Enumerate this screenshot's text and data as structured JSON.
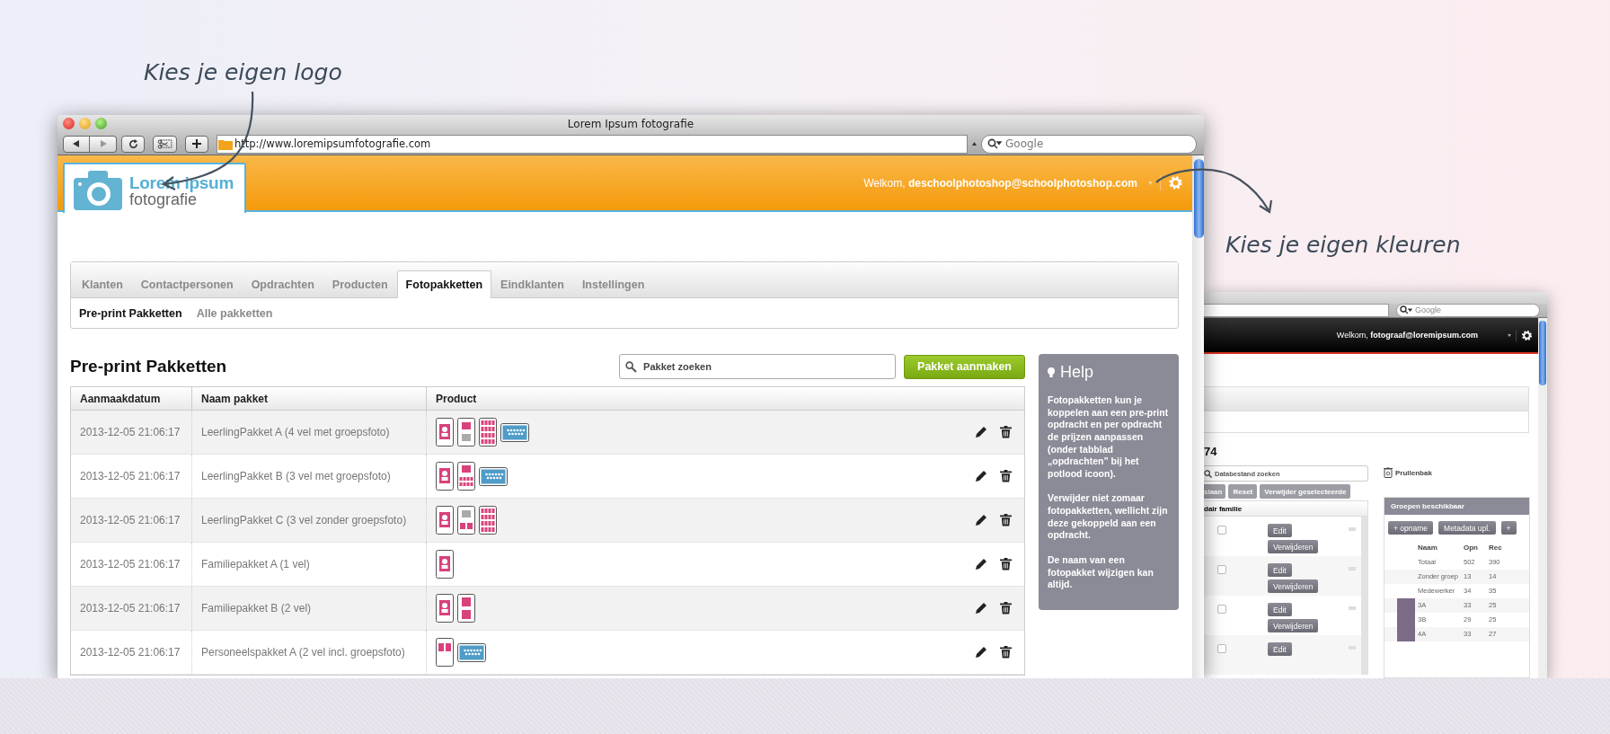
{
  "annotations": [
    {
      "text": "Kies je eigen logo"
    },
    {
      "text": "Kies je eigen kleuren"
    }
  ],
  "main_window": {
    "title": "Lorem Ipsum fotografie",
    "url": "http://www.loremipsumfotografie.com",
    "search_placeholder": "Google",
    "logo": {
      "name": "Lorem ipsum",
      "subtitle": "fotografie"
    },
    "welcome": {
      "label": "Welkom,",
      "user": "deschoolphotoshop@schoolphotoshop.com"
    },
    "tabs": [
      {
        "label": "Klanten",
        "selected": false
      },
      {
        "label": "Contactpersonen",
        "selected": false
      },
      {
        "label": "Opdrachten",
        "selected": false
      },
      {
        "label": "Producten",
        "selected": false
      },
      {
        "label": "Fotopakketten",
        "selected": true
      },
      {
        "label": "Eindklanten",
        "selected": false
      },
      {
        "label": "Instellingen",
        "selected": false
      }
    ],
    "subtabs": [
      {
        "label": "Pre-print Pakketten",
        "selected": true
      },
      {
        "label": "Alle pakketten",
        "selected": false
      }
    ],
    "heading": "Pre-print Pakketten",
    "search": {
      "placeholder": "Pakket zoeken"
    },
    "create_button": "Pakket aanmaken",
    "table": {
      "columns": [
        "Aanmaakdatum",
        "Naam pakket",
        "Product"
      ],
      "rows": [
        {
          "date": "2013-12-05 21:06:17",
          "name": "LeerlingPakket A (4 vel met groepsfoto)",
          "products": [
            {
              "kind": "portrait"
            },
            {
              "kind": "split"
            },
            {
              "kind": "grid"
            },
            {
              "kind": "group"
            }
          ]
        },
        {
          "date": "2013-12-05 21:06:17",
          "name": "LeerlingPakket B (3 vel met groepsfoto)",
          "products": [
            {
              "kind": "portrait"
            },
            {
              "kind": "split-grid"
            },
            {
              "kind": "group"
            }
          ]
        },
        {
          "date": "2013-12-05 21:06:17",
          "name": "LeerlingPakket C (3 vel zonder groepsfoto)",
          "products": [
            {
              "kind": "portrait"
            },
            {
              "kind": "split-pair"
            },
            {
              "kind": "grid"
            }
          ]
        },
        {
          "date": "2013-12-05 21:06:17",
          "name": "Familiepakket A (1 vel)",
          "products": [
            {
              "kind": "portrait"
            }
          ]
        },
        {
          "date": "2013-12-05 21:06:17",
          "name": "Familiepakket B (2 vel)",
          "products": [
            {
              "kind": "portrait"
            },
            {
              "kind": "double"
            }
          ]
        },
        {
          "date": "2013-12-05 21:06:17",
          "name": "Personeelspakket A (2 vel incl. groepsfoto)",
          "products": [
            {
              "kind": "pair"
            },
            {
              "kind": "group"
            }
          ]
        }
      ]
    },
    "help": {
      "title": "Help",
      "paragraphs": [
        "Fotopakketten kun je koppelen aan een pre-print opdracht en per opdracht de prijzen aanpassen (onder tabblad „opdrachten” bij het potlood icoon).",
        "Verwijder niet zomaar fotopakketten, wellicht zijn deze gekoppeld aan een opdracht.",
        "De naam van een fotopakket wijzigen kan altijd."
      ]
    }
  },
  "second_window": {
    "search_placeholder": "Google",
    "welcome": {
      "label": "Welkom,",
      "user": "fotograaf@loremipsum.com"
    },
    "heading": "74",
    "search": {
      "placeholder": "Databestand zoeken"
    },
    "buttons": [
      "slaan",
      "Reset",
      "Verwijder geselecteerde"
    ],
    "list_header": "dair familie",
    "rows": [
      {
        "checked": false,
        "buttons": [
          "Edit",
          "Verwijderen"
        ]
      },
      {
        "checked": false,
        "buttons": [
          "Edit",
          "Verwijderen"
        ]
      },
      {
        "checked": false,
        "buttons": [
          "Edit",
          "Verwijderen"
        ]
      },
      {
        "checked": false,
        "buttons": [
          "Edit"
        ]
      }
    ],
    "trash_label": "Prullenbak",
    "groups": {
      "title": "Groepen beschikbaar",
      "buttons": [
        "+ opname",
        "Metadata upl.",
        "+"
      ],
      "columns": [
        "Naam",
        "Opn",
        "Rec"
      ],
      "rows": [
        {
          "name": "Totaal",
          "opn": "502",
          "rec": "390",
          "photo": false
        },
        {
          "name": "Zonder groep",
          "opn": "13",
          "rec": "14",
          "photo": false
        },
        {
          "name": "Medewerker",
          "opn": "34",
          "rec": "35",
          "photo": false
        },
        {
          "name": "3A",
          "opn": "33",
          "rec": "25",
          "photo": true
        },
        {
          "name": "3B",
          "opn": "29",
          "rec": "25",
          "photo": true
        },
        {
          "name": "4A",
          "opn": "33",
          "rec": "27",
          "photo": true
        }
      ]
    }
  }
}
